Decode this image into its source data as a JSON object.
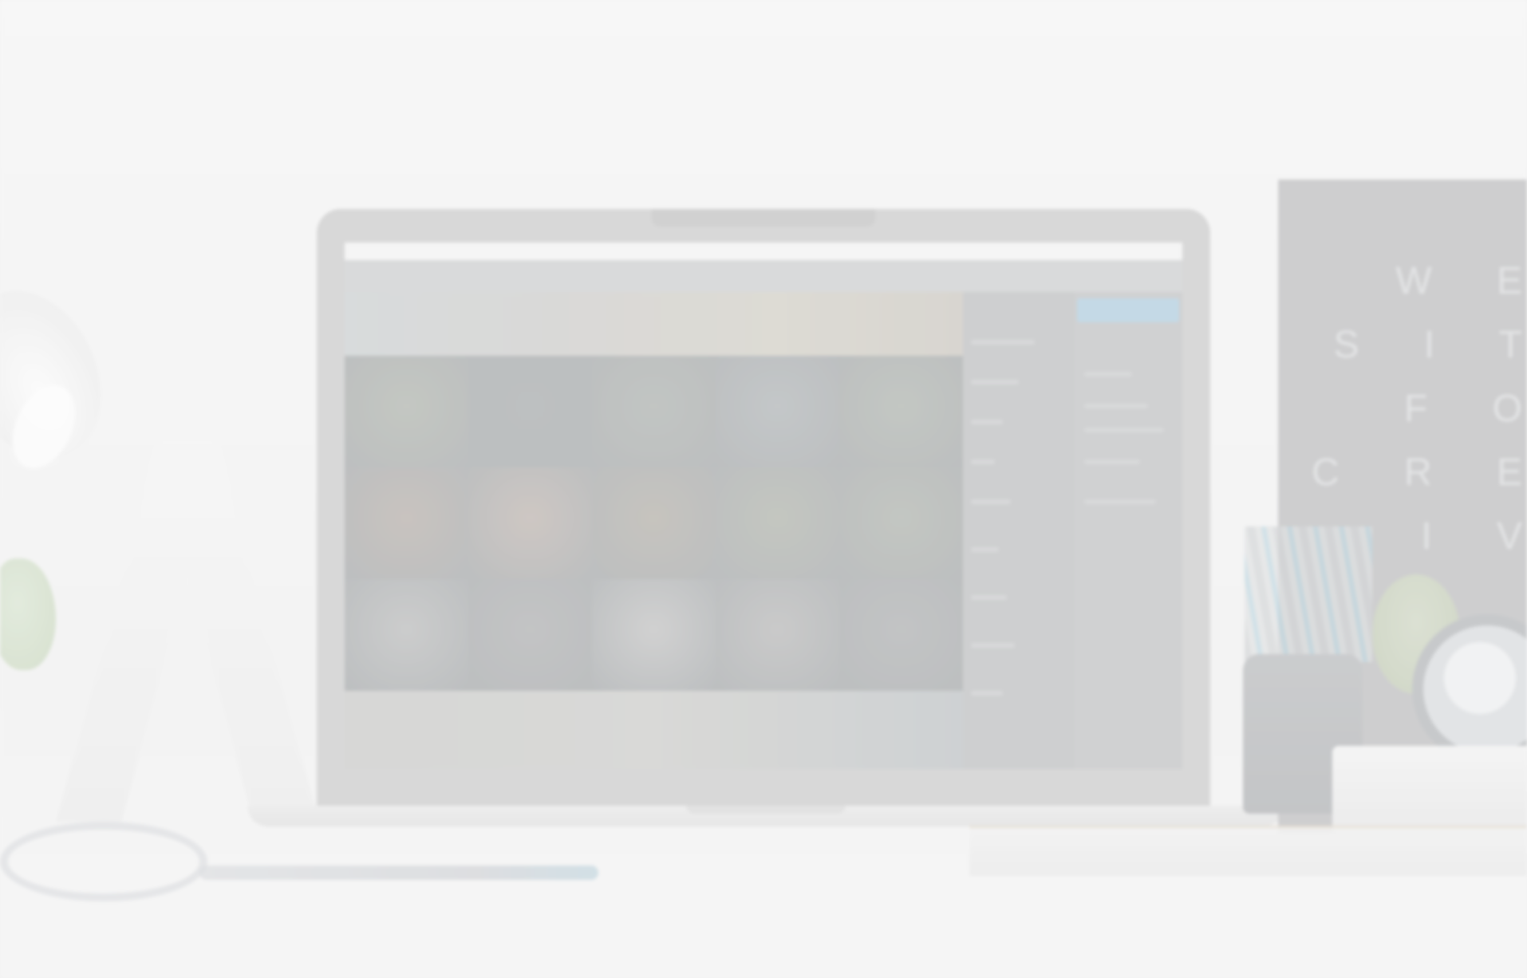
{
  "scene": {
    "description_text": "",
    "poster_lines": [
      "W E",
      "S I T",
      "F O",
      "C R E",
      "I V"
    ]
  },
  "colors": {
    "background": "#f3f3f3",
    "laptop_body": "#c8c8c8",
    "screen_accent": "#a9c9de",
    "poster": "#b8b9bb"
  },
  "screen_grid": {
    "cells": [
      "#a9aea6",
      "#9ea3a5",
      "#a6aba7",
      "#a9aeb0",
      "#a8aea7",
      "#b0a8a2",
      "#b8aea8",
      "#ada9a0",
      "#a9ada4",
      "#a8ada6",
      "#b5b6b6",
      "#a8a9aa",
      "#bdbdbd",
      "#b2b2b2",
      "#a7a9aa"
    ]
  }
}
